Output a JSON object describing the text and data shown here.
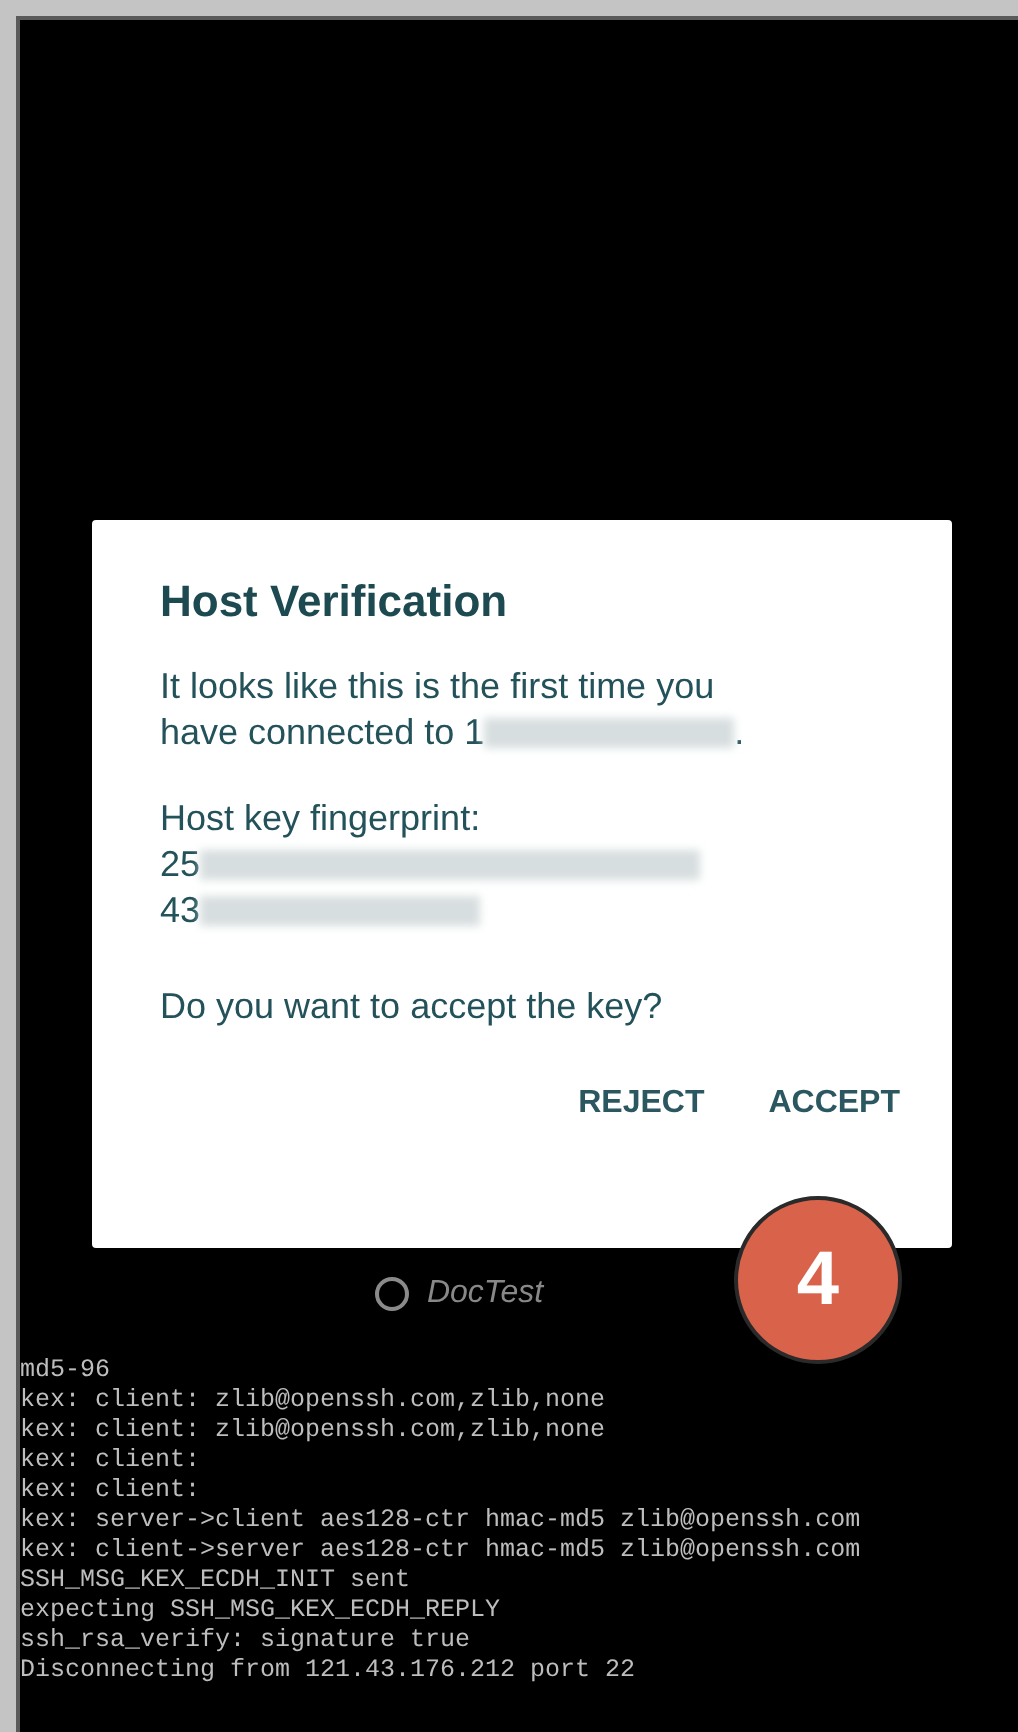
{
  "dialog": {
    "title": "Host Verification",
    "message_lines": [
      "It looks like this is the first time you",
      "have connected to 1"
    ],
    "message_end": ".",
    "fingerprint_label": "Host key fingerprint:",
    "fingerprint_lines": [
      "25",
      "43"
    ],
    "question": "Do you want to accept the key?",
    "buttons": [
      "REJECT",
      "ACCEPT"
    ]
  },
  "step_badge": "4",
  "connection": {
    "name": "DocTest"
  },
  "terminal_lines": [
    "md5-96",
    "kex: client: zlib@openssh.com,zlib,none",
    "kex: client: zlib@openssh.com,zlib,none",
    "kex: client:",
    "kex: client:",
    "kex: server->client aes128-ctr hmac-md5 zlib@openssh.com",
    "kex: client->server aes128-ctr hmac-md5 zlib@openssh.com",
    "SSH_MSG_KEX_ECDH_INIT sent",
    "expecting SSH_MSG_KEX_ECDH_REPLY",
    "ssh_rsa_verify: signature true",
    "Disconnecting from 121.43.176.212 port 22"
  ]
}
